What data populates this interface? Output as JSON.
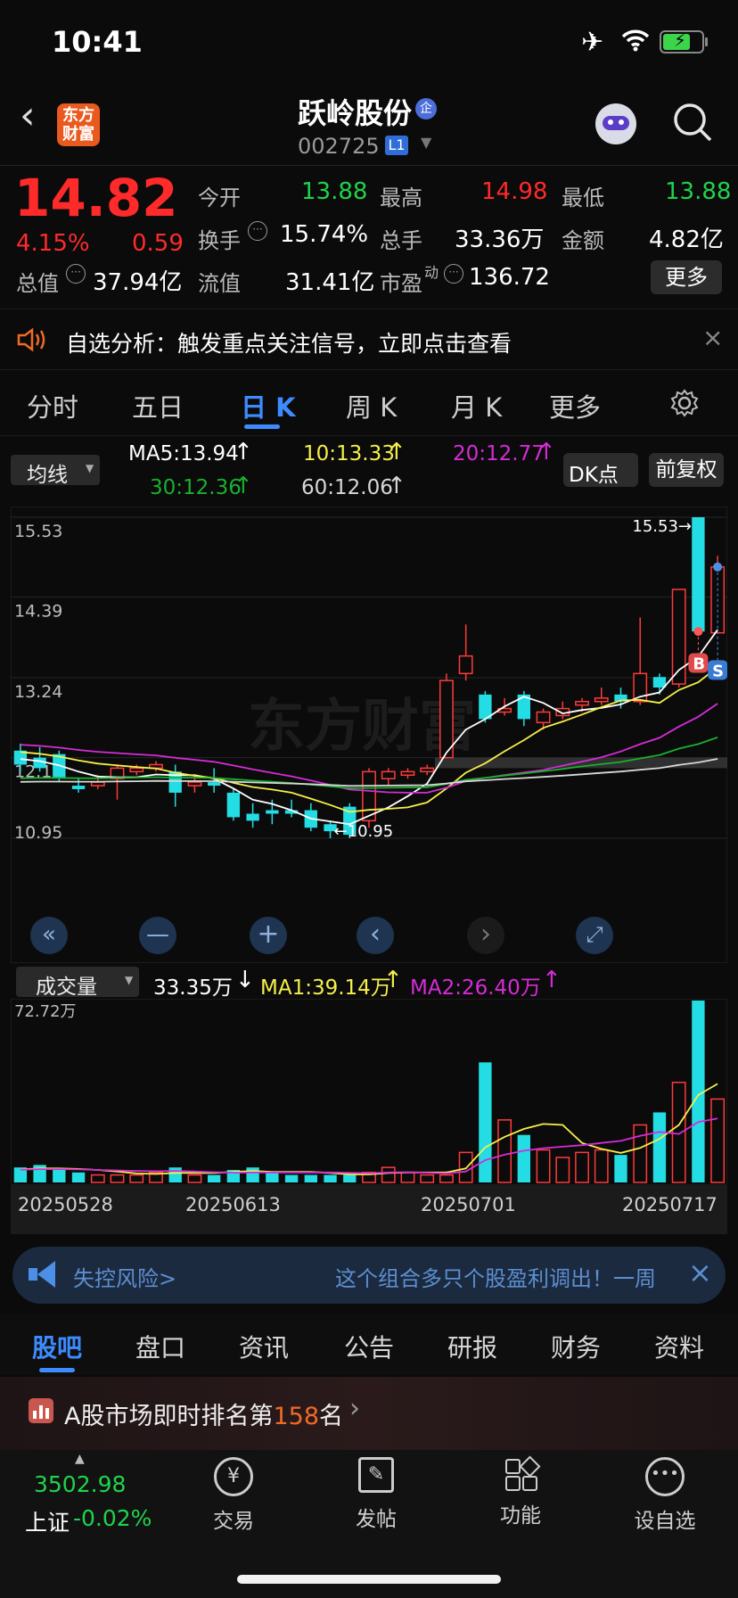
{
  "status_bar": {
    "time": "10:41"
  },
  "header": {
    "logo_text": "东方财富",
    "stock_name": "跃岭股份",
    "badge": "企",
    "stock_code": "002725",
    "level": "L1"
  },
  "quote": {
    "price": "14.82",
    "change_pct": "4.15%",
    "change_amt": "0.59",
    "open_label": "今开",
    "open": "13.88",
    "high_label": "最高",
    "high": "14.98",
    "low_label": "最低",
    "low": "13.88",
    "turnover_label": "换手",
    "turnover": "15.74%",
    "volume_label": "总手",
    "volume": "33.36万",
    "amount_label": "金额",
    "amount": "4.82亿",
    "mktcap_label": "总值",
    "mktcap": "37.94亿",
    "float_label": "流值",
    "float_cap": "31.41亿",
    "pe_label": "市盈",
    "pe_sup": "动",
    "pe": "136.72",
    "more_label": "更多"
  },
  "notice": {
    "text": "自选分析：触发重点关注信号，立即点击查看"
  },
  "chart_tabs": [
    "分时",
    "五日",
    "日 K",
    "周 K",
    "月 K",
    "更多"
  ],
  "active_chart_tab": "日 K",
  "ma_bar": {
    "selector": "均线",
    "ma5": "MA5:13.94",
    "ma10": "10:13.33",
    "ma20": "20:12.77",
    "ma30": "30:12.36",
    "ma60": "60:12.06",
    "dk_label": "DK点",
    "adjust_label": "前复权"
  },
  "volume_bar": {
    "selector": "成交量",
    "volume": "33.35万",
    "ma1": "MA1:39.14万",
    "ma2": "MA2:26.40万"
  },
  "chart_data": {
    "type": "candlestick",
    "y_ticks": [
      "15.53",
      "14.39",
      "13.24",
      "12.10",
      "10.95"
    ],
    "ylim": [
      10.95,
      15.53
    ],
    "high_annotation": "15.53",
    "low_annotation": "10.95",
    "buy_marker": "B",
    "sell_marker": "S",
    "watermark": "东方财富",
    "candles": [
      {
        "o": 12.2,
        "c": 12.0,
        "h": 12.3,
        "l": 11.9
      },
      {
        "o": 12.1,
        "c": 11.95,
        "h": 12.25,
        "l": 11.9
      },
      {
        "o": 12.15,
        "c": 11.8,
        "h": 12.2,
        "l": 11.75
      },
      {
        "o": 11.7,
        "c": 11.65,
        "h": 11.8,
        "l": 11.6
      },
      {
        "o": 11.7,
        "c": 11.75,
        "h": 11.85,
        "l": 11.65
      },
      {
        "o": 11.8,
        "c": 11.95,
        "h": 12.0,
        "l": 11.5
      },
      {
        "o": 11.9,
        "c": 11.95,
        "h": 12.0,
        "l": 11.85
      },
      {
        "o": 11.95,
        "c": 12.0,
        "h": 12.05,
        "l": 11.9
      },
      {
        "o": 11.9,
        "c": 11.6,
        "h": 12.0,
        "l": 11.4
      },
      {
        "o": 11.7,
        "c": 11.75,
        "h": 11.85,
        "l": 11.6
      },
      {
        "o": 11.75,
        "c": 11.7,
        "h": 11.95,
        "l": 11.6
      },
      {
        "o": 11.6,
        "c": 11.25,
        "h": 11.65,
        "l": 11.2
      },
      {
        "o": 11.3,
        "c": 11.2,
        "h": 11.45,
        "l": 11.1
      },
      {
        "o": 11.35,
        "c": 11.3,
        "h": 11.5,
        "l": 11.15
      },
      {
        "o": 11.35,
        "c": 11.3,
        "h": 11.5,
        "l": 11.25
      },
      {
        "o": 11.35,
        "c": 11.1,
        "h": 11.45,
        "l": 11.05
      },
      {
        "o": 11.15,
        "c": 11.05,
        "h": 11.2,
        "l": 10.95
      },
      {
        "o": 11.4,
        "c": 11.0,
        "h": 11.45,
        "l": 10.95
      },
      {
        "o": 11.2,
        "c": 11.9,
        "h": 11.95,
        "l": 11.1
      },
      {
        "o": 11.8,
        "c": 11.9,
        "h": 11.95,
        "l": 11.7
      },
      {
        "o": 11.85,
        "c": 11.9,
        "h": 11.95,
        "l": 11.8
      },
      {
        "o": 11.9,
        "c": 11.95,
        "h": 12.0,
        "l": 11.85
      },
      {
        "o": 12.1,
        "c": 13.2,
        "h": 13.3,
        "l": 12.1
      },
      {
        "o": 13.3,
        "c": 13.55,
        "h": 14.0,
        "l": 13.2
      },
      {
        "o": 13.0,
        "c": 12.65,
        "h": 13.05,
        "l": 12.6
      },
      {
        "o": 12.75,
        "c": 12.8,
        "h": 12.95,
        "l": 12.7
      },
      {
        "o": 13.0,
        "c": 12.65,
        "h": 13.05,
        "l": 12.55
      },
      {
        "o": 12.6,
        "c": 12.75,
        "h": 12.8,
        "l": 12.5
      },
      {
        "o": 12.7,
        "c": 12.8,
        "h": 12.9,
        "l": 12.65
      },
      {
        "o": 12.85,
        "c": 12.9,
        "h": 12.95,
        "l": 12.75
      },
      {
        "o": 12.9,
        "c": 12.95,
        "h": 13.1,
        "l": 12.85
      },
      {
        "o": 13.0,
        "c": 12.9,
        "h": 13.1,
        "l": 12.8
      },
      {
        "o": 12.9,
        "c": 13.3,
        "h": 14.1,
        "l": 12.85
      },
      {
        "o": 13.25,
        "c": 13.1,
        "h": 13.3,
        "l": 13.0
      },
      {
        "o": 13.15,
        "c": 14.5,
        "h": 14.5,
        "l": 13.1
      },
      {
        "o": 15.53,
        "c": 13.9,
        "h": 15.53,
        "l": 13.85
      },
      {
        "o": 13.88,
        "c": 14.82,
        "h": 14.98,
        "l": 13.88
      }
    ],
    "volume": {
      "ylim": [
        0,
        72.72
      ],
      "top_label": "72.72万",
      "values": [
        6,
        7,
        5,
        4,
        3,
        3,
        3,
        4,
        6,
        3,
        3,
        5,
        6,
        4,
        3,
        3,
        3,
        3,
        4,
        6,
        4,
        3,
        3,
        12,
        48,
        25,
        19,
        13,
        10,
        12,
        13,
        11,
        23,
        28,
        40,
        72.72,
        33.35
      ]
    },
    "x_labels": [
      "20250528",
      "20250613",
      "20250701",
      "20250717"
    ]
  },
  "banner": {
    "left_text": "失控风险>",
    "right_text": "这个组合多只个股盈利调出！一周"
  },
  "section_tabs": [
    "股吧",
    "盘口",
    "资讯",
    "公告",
    "研报",
    "财务",
    "资料"
  ],
  "active_section_tab": "股吧",
  "ranking": {
    "prefix": "A股市场即时排名第",
    "rank": "158",
    "suffix": "名"
  },
  "index": {
    "value": "3502.98",
    "name": "上证",
    "change": "-0.02%"
  },
  "bottom_nav": [
    {
      "label": "交易",
      "icon": "trade-yen-icon"
    },
    {
      "label": "发帖",
      "icon": "edit-icon"
    },
    {
      "label": "功能",
      "icon": "grid-icon"
    },
    {
      "label": "设自选",
      "icon": "more-dots-icon"
    }
  ]
}
